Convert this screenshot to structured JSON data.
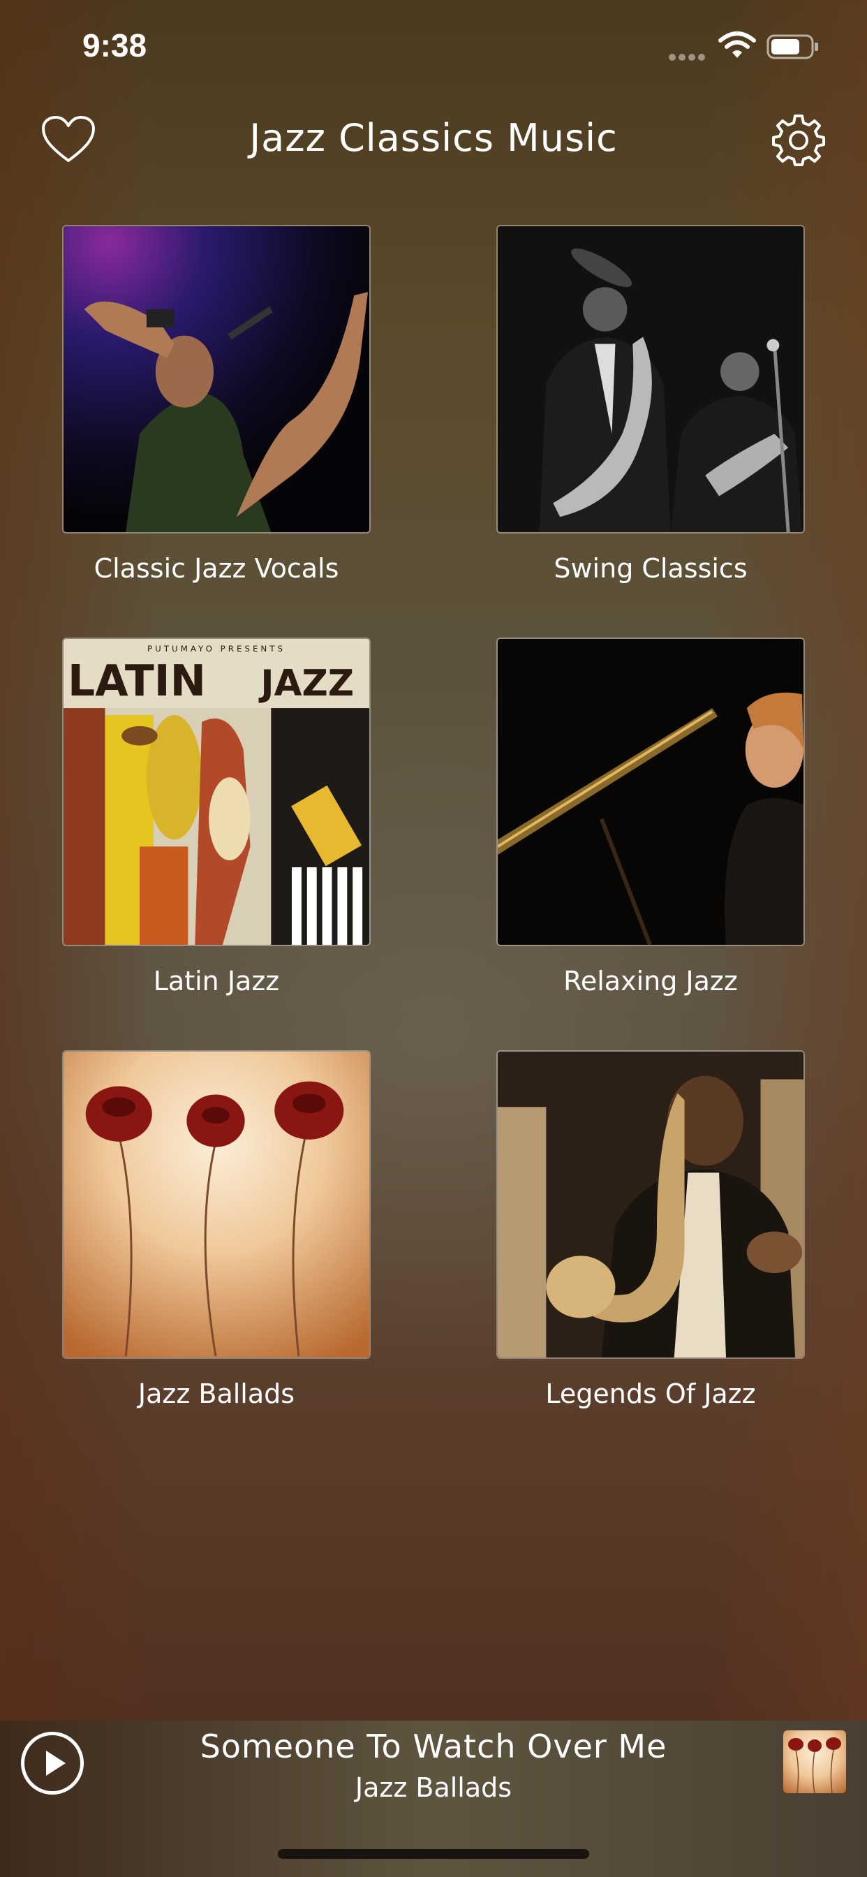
{
  "status_bar": {
    "time": "9:38",
    "icons": [
      "signal-icon",
      "wifi-icon",
      "battery-icon"
    ]
  },
  "nav": {
    "title": "Jazz Classics Music",
    "left_icon": "heart-icon",
    "right_icon": "gear-icon"
  },
  "categories": [
    {
      "label": "Classic Jazz Vocals"
    },
    {
      "label": "Swing Classics"
    },
    {
      "label": "Latin Jazz",
      "art_text_top": "PUTUMAYO PRESENTS",
      "art_text_left": "LATIN",
      "art_text_right": "JAZZ"
    },
    {
      "label": "Relaxing Jazz"
    },
    {
      "label": "Jazz Ballads"
    },
    {
      "label": "Legends Of Jazz"
    }
  ],
  "player": {
    "title": "Someone To Watch Over Me",
    "subtitle": "Jazz Ballads",
    "play_icon": "play-icon"
  },
  "colors": {
    "background_top": "#4a3a1e",
    "background_mid": "#5d5440",
    "background_bottom": "#4d2a1e",
    "text": "#ffffff"
  }
}
